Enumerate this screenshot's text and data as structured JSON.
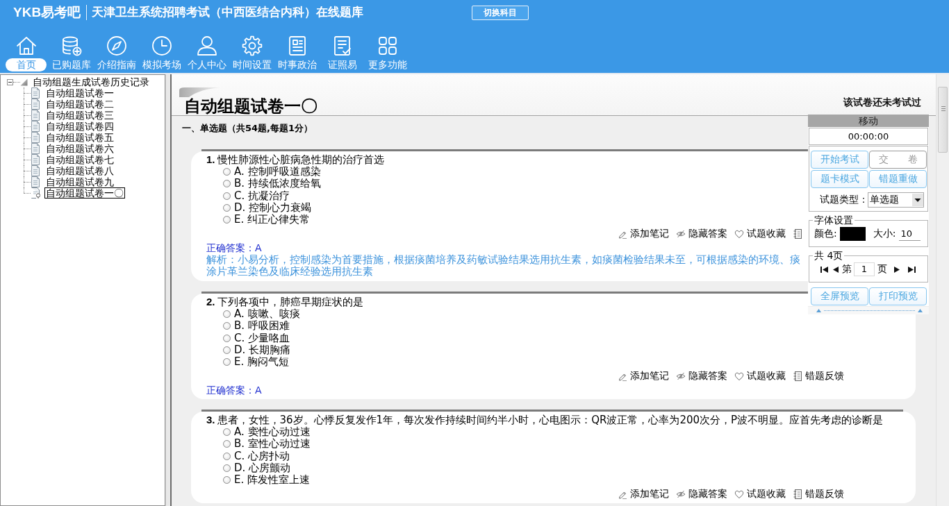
{
  "header": {
    "logo": "YKB易考吧",
    "title": "天津卫生系统招聘考试（中西医结合内科）在线题库",
    "switch_button": "切换科目",
    "nav": [
      {
        "kind": "home",
        "label": "首页",
        "selected": true
      },
      {
        "kind": "purchased",
        "label": "已购题库",
        "selected": false
      },
      {
        "kind": "guide",
        "label": "介绍指南",
        "selected": false
      },
      {
        "kind": "exam",
        "label": "模拟考场",
        "selected": false
      },
      {
        "kind": "profile",
        "label": "个人中心",
        "selected": false
      },
      {
        "kind": "settings",
        "label": "时间设置",
        "selected": false
      },
      {
        "kind": "news",
        "label": "时事政治",
        "selected": false
      },
      {
        "kind": "license",
        "label": "证照易",
        "selected": false
      },
      {
        "kind": "more",
        "label": "更多功能",
        "selected": false
      }
    ]
  },
  "sidebar": {
    "tree": [
      {
        "label": "自动组题生成试卷历史记录",
        "expanded": true,
        "selected": false,
        "children": [
          {
            "label": "自动组题试卷一",
            "selected": false
          },
          {
            "label": "自动组题试卷二",
            "selected": false
          },
          {
            "label": "自动组题试卷三",
            "selected": false
          },
          {
            "label": "自动组题试卷四",
            "selected": false
          },
          {
            "label": "自动组题试卷五",
            "selected": false
          },
          {
            "label": "自动组题试卷六",
            "selected": false
          },
          {
            "label": "自动组题试卷七",
            "selected": false
          },
          {
            "label": "自动组题试卷八",
            "selected": false
          },
          {
            "label": "自动组题试卷九",
            "selected": false
          },
          {
            "label": "自动组题试卷一〇",
            "selected": true
          }
        ]
      }
    ]
  },
  "paper": {
    "title": "自动组题试卷一〇",
    "status": "该试卷还未考试过",
    "section": "一、单选题（共54题,每题1分）",
    "questions": [
      {
        "number": "1.",
        "text": "慢性肺源性心脏病急性期的治疗首选",
        "options": [
          {
            "label": "A. 控制呼吸道感染",
            "selected": false
          },
          {
            "label": "B. 持续低浓度给氧",
            "selected": false
          },
          {
            "label": "C. 抗凝治疗",
            "selected": false
          },
          {
            "label": "D. 控制心力衰竭",
            "selected": false
          },
          {
            "label": "E. 纠正心律失常",
            "selected": false
          }
        ],
        "actions": [
          {
            "kind": "note",
            "label": "添加笔记"
          },
          {
            "kind": "hide",
            "label": "隐藏答案"
          },
          {
            "kind": "favorite",
            "label": "试题收藏"
          },
          {
            "kind": "report"
          }
        ],
        "answer": "正确答案：A",
        "explanation": "解析：小易分析，控制感染为首要措施，根据痰菌培养及药敏试验结果选用抗生素，如痰菌检验结果未至，可根据感染的环境、痰涂片革兰染色及临床经验选用抗生素"
      },
      {
        "number": "2.",
        "text": "下列各项中，肺癌早期症状的是",
        "options": [
          {
            "label": "A. 咳嗽、咳痰",
            "selected": false
          },
          {
            "label": "B. 呼吸困难",
            "selected": false
          },
          {
            "label": "C. 少量咯血",
            "selected": false
          },
          {
            "label": "D. 长期胸痛",
            "selected": false
          },
          {
            "label": "E. 胸闷气短",
            "selected": false
          }
        ],
        "actions": [
          {
            "kind": "note",
            "label": "添加笔记"
          },
          {
            "kind": "hide",
            "label": "隐藏答案"
          },
          {
            "kind": "favorite",
            "label": "试题收藏"
          },
          {
            "kind": "report",
            "label": "错题反馈"
          }
        ],
        "answer": "正确答案：A"
      },
      {
        "number": "3.",
        "text": "患者，女性，36岁。心悸反复发作1年，每次发作持续时间约半小时，心电图示：QR波正常，心率为200次分，P波不明显。应首先考虑的诊断是",
        "options": [
          {
            "label": "A. 窦性心动过速",
            "selected": false
          },
          {
            "label": "B. 室性心动过速",
            "selected": false
          },
          {
            "label": "C. 心房扑动",
            "selected": false
          },
          {
            "label": "D. 心房颤动",
            "selected": false
          },
          {
            "label": "E. 阵发性室上速",
            "selected": false
          }
        ],
        "actions": [
          {
            "kind": "note",
            "label": "添加笔记"
          },
          {
            "kind": "hide",
            "label": "隐藏答案"
          },
          {
            "kind": "favorite",
            "label": "试题收藏"
          },
          {
            "kind": "report",
            "label": "错题反馈"
          }
        ]
      }
    ]
  },
  "panel": {
    "header": "移动",
    "timer": "00:00:00",
    "buttons": [
      {
        "label": "开始考试",
        "disabled": false
      },
      {
        "label": "交　　卷",
        "disabled": true
      },
      {
        "label": "题卡模式",
        "disabled": false
      },
      {
        "label": "错题重做",
        "disabled": false
      }
    ],
    "type_label": "试题类型：",
    "type_value": "单选题",
    "font_group": "字体设置",
    "color_label": "颜色:",
    "size_label": "大小:",
    "size_value": "10",
    "pages_group": "共 4页",
    "page_prefix": "第",
    "page_value": "1",
    "page_suffix": "页",
    "preview_buttons": [
      "全屏预览",
      "打印预览"
    ]
  }
}
